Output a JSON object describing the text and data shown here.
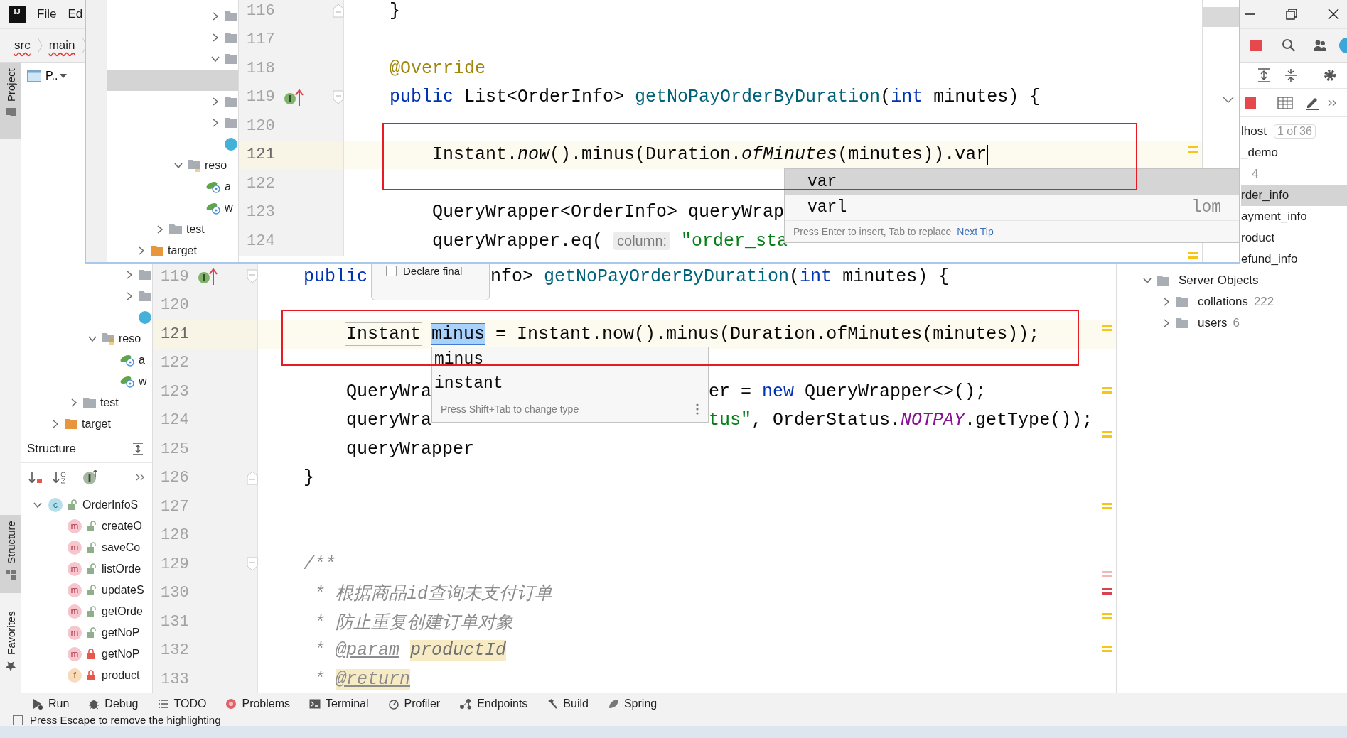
{
  "title_bar": {
    "logo": "IJ",
    "menu": [
      "File",
      "Ed"
    ]
  },
  "breadcrumbs": [
    "src",
    "main"
  ],
  "tool_stripes": [
    {
      "label": "Project",
      "selected": true
    },
    {
      "label": "Structure",
      "selected": true
    },
    {
      "label": "Favorites",
      "selected": false
    }
  ],
  "project_panel": {
    "title": "P..",
    "tree": [
      {
        "children": [
          {
            "children": [
              {
                "children": [
                  {
                    "children": [
                      {
                        "kind": "folder",
                        "expanded": false,
                        "selected": false
                      },
                      {
                        "kind": "folder",
                        "expanded": false,
                        "selected": false
                      },
                      {
                        "kind": "class",
                        "selected": false
                      }
                    ]
                  }
                ]
              },
              {
                "kind": "resources",
                "label": "reso",
                "expanded": true,
                "selected": false,
                "children": [
                  {
                    "kind": "config",
                    "label": "a",
                    "selected": false
                  },
                  {
                    "kind": "config",
                    "label": "w",
                    "selected": false
                  }
                ]
              }
            ]
          },
          {
            "kind": "folder",
            "label": "test",
            "expanded": false,
            "selected": false
          }
        ]
      },
      {
        "kind": "excluded",
        "label": "target",
        "expanded": false,
        "selected": false
      }
    ]
  },
  "structure_panel": {
    "title": "Structure",
    "tree": [
      {
        "label": "OrderInfoS",
        "kind": "class",
        "icon_text": "c",
        "locked": false,
        "expanded": true,
        "selected": false,
        "children": [
          {
            "label": "createO",
            "kind": "method",
            "icon_text": "m",
            "locked": false,
            "selected": false
          },
          {
            "label": "saveCo",
            "kind": "method",
            "icon_text": "m",
            "locked": false,
            "selected": false
          },
          {
            "label": "listOrde",
            "kind": "method",
            "icon_text": "m",
            "locked": false,
            "selected": false
          },
          {
            "label": "updateS",
            "kind": "method",
            "icon_text": "m",
            "locked": false,
            "selected": false
          },
          {
            "label": "getOrde",
            "kind": "method",
            "icon_text": "m",
            "locked": false,
            "selected": false
          },
          {
            "label": "getNoP",
            "kind": "method",
            "icon_text": "m",
            "locked": false,
            "selected": false
          },
          {
            "label": "getNoP",
            "kind": "method",
            "icon_text": "m",
            "locked": true,
            "selected": false
          },
          {
            "label": "product",
            "kind": "field",
            "icon_text": "f",
            "locked": true,
            "selected": false
          }
        ]
      }
    ]
  },
  "editor": {
    "lines": [
      {
        "n": "119",
        "current": false,
        "fold_start": true,
        "implements": true,
        "tokens": [
          {
            "kind": "kw",
            "t": "public"
          },
          {
            "kind": "gap_hint"
          },
          {
            "kind": "plain",
            "t": "nfo> "
          },
          {
            "kind": "fn",
            "t": "getNoPayOrderByDuration"
          },
          {
            "kind": "plain",
            "t": "("
          },
          {
            "kind": "kw",
            "t": "int"
          },
          {
            "kind": "plain",
            "t": " minutes) {"
          }
        ]
      },
      {
        "n": "120",
        "current": false
      },
      {
        "n": "121",
        "current": true,
        "indented": true,
        "tokens": [
          {
            "kind": "box",
            "t": "Instant"
          },
          {
            "kind": "sel",
            "t": "minus"
          },
          {
            "kind": "plain",
            "t": " = Instant.now().minus(Duration.ofMinutes(minutes));"
          }
        ]
      },
      {
        "n": "122",
        "current": false
      },
      {
        "n": "123",
        "current": false,
        "indented": true,
        "tokens": [
          {
            "kind": "plain",
            "t": "QueryWra"
          },
          {
            "kind": "gap_completion"
          },
          {
            "kind": "plain",
            "t": "er = "
          },
          {
            "kind": "kw",
            "t": "new"
          },
          {
            "kind": "plain",
            "t": " QueryWrapper<>();"
          }
        ]
      },
      {
        "n": "124",
        "current": false,
        "indented": true,
        "tokens": [
          {
            "kind": "plain",
            "t": "queryWra"
          },
          {
            "kind": "gap_completion"
          },
          {
            "kind": "str",
            "t": "tus\""
          },
          {
            "kind": "plain",
            "t": ", OrderStatus."
          },
          {
            "kind": "const",
            "t": "NOTPAY"
          },
          {
            "kind": "plain",
            "t": ".getType());"
          }
        ]
      },
      {
        "n": "125",
        "current": false,
        "indented": true,
        "tokens": [
          {
            "kind": "plain",
            "t": "queryWrapper"
          }
        ]
      },
      {
        "n": "126",
        "current": false,
        "fold_end": true,
        "tokens": [
          {
            "kind": "plain",
            "t": "}"
          }
        ]
      },
      {
        "n": "127",
        "current": false
      },
      {
        "n": "128",
        "current": false
      },
      {
        "n": "129",
        "current": false,
        "fold_start": true,
        "tokens": [
          {
            "kind": "comment",
            "t": "/**"
          }
        ]
      },
      {
        "n": "130",
        "current": false,
        "tokens": [
          {
            "kind": "comment",
            "t": " * 根据商品id查询未支付订单"
          }
        ]
      },
      {
        "n": "131",
        "current": false,
        "tokens": [
          {
            "kind": "comment",
            "t": " * 防止重复创建订单对象"
          }
        ]
      },
      {
        "n": "132",
        "current": false,
        "tokens": [
          {
            "kind": "comment",
            "t": " * "
          },
          {
            "kind": "doctag",
            "t": "@param"
          },
          {
            "kind": "docparam",
            "t": "productId"
          }
        ]
      },
      {
        "n": "133",
        "current": false,
        "tokens": [
          {
            "kind": "comment",
            "t": " * "
          },
          {
            "kind": "doctaghl",
            "t": "@return"
          }
        ]
      }
    ],
    "completion": {
      "items": [
        {
          "label": "minus",
          "selected": false
        },
        {
          "label": "instant",
          "selected": false
        }
      ],
      "hint": "Press Shift+Tab to change type"
    },
    "declare_final": {
      "label": "Declare final",
      "checked": false
    }
  },
  "database_panel": {
    "covered_rows": [
      {
        "label": "lhost",
        "badge": "1 of 36",
        "selected": false
      },
      {
        "label": "_demo",
        "selected": false
      },
      {
        "count": "4",
        "selected": false
      },
      {
        "label": "rder_info",
        "selected": true
      },
      {
        "label": "ayment_info",
        "selected": false
      },
      {
        "label": "roduct",
        "selected": false
      },
      {
        "label": "efund_info",
        "selected": false
      }
    ],
    "tree": [
      {
        "label": "Server Objects",
        "kind": "folder",
        "expanded": true,
        "selected": false,
        "children": [
          {
            "label": "collations",
            "count": "222",
            "kind": "folder",
            "expanded": false,
            "selected": false
          },
          {
            "label": "users",
            "count": "6",
            "kind": "folder",
            "expanded": false,
            "selected": false
          }
        ]
      }
    ]
  },
  "tool_window_bar": [
    {
      "label": "Run",
      "kind": "run"
    },
    {
      "label": "Debug",
      "kind": "debug"
    },
    {
      "label": "TODO",
      "kind": "todo"
    },
    {
      "label": "Problems",
      "kind": "problems"
    },
    {
      "label": "Terminal",
      "kind": "terminal"
    },
    {
      "label": "Profiler",
      "kind": "profiler"
    },
    {
      "label": "Endpoints",
      "kind": "endpoints"
    },
    {
      "label": "Build",
      "kind": "build"
    },
    {
      "label": "Spring",
      "kind": "spring"
    }
  ],
  "status_bar": {
    "message": "Press Escape to remove the highlighting"
  },
  "overlay": {
    "project_tree": [
      {
        "children": [
          {
            "children": [
              {
                "children": [
                  {
                    "children": [
                      {
                        "kind": "folder",
                        "expanded": false,
                        "selected": false
                      },
                      {
                        "kind": "folder",
                        "expanded": false,
                        "selected": false
                      },
                      {
                        "kind": "folder",
                        "expanded": true,
                        "selected": false,
                        "children": [
                          {
                            "selected": true
                          }
                        ]
                      },
                      {
                        "kind": "folder",
                        "expanded": false,
                        "selected": false
                      },
                      {
                        "kind": "folder",
                        "expanded": false,
                        "selected": false
                      },
                      {
                        "kind": "class",
                        "selected": false
                      }
                    ]
                  }
                ]
              },
              {
                "kind": "resources",
                "label": "reso",
                "expanded": true,
                "selected": false,
                "children": [
                  {
                    "kind": "config",
                    "label": "a",
                    "selected": false
                  },
                  {
                    "kind": "config",
                    "label": "w",
                    "selected": false
                  }
                ]
              }
            ]
          },
          {
            "kind": "folder",
            "label": "test",
            "expanded": false,
            "selected": false
          }
        ]
      },
      {
        "kind": "excluded",
        "label": "target",
        "expanded": false,
        "selected": false
      }
    ],
    "lines": [
      {
        "n": "116",
        "current": false,
        "fold_end": true,
        "tokens": [
          {
            "kind": "plain",
            "t": "}"
          }
        ]
      },
      {
        "n": "117",
        "current": false
      },
      {
        "n": "118",
        "current": false,
        "tokens": [
          {
            "kind": "ann",
            "t": "@Override"
          }
        ]
      },
      {
        "n": "119",
        "current": false,
        "fold_start": true,
        "implements": true,
        "tokens": [
          {
            "kind": "kw",
            "t": "public"
          },
          {
            "kind": "plain",
            "t": " List<OrderInfo> "
          },
          {
            "kind": "fn",
            "t": "getNoPayOrderByDuration"
          },
          {
            "kind": "plain",
            "t": "("
          },
          {
            "kind": "kw",
            "t": "int"
          },
          {
            "kind": "plain",
            "t": " minutes) {"
          }
        ]
      },
      {
        "n": "120",
        "current": false
      },
      {
        "n": "121",
        "current": true,
        "indented": true,
        "tokens": [
          {
            "kind": "plain",
            "t": "Instant."
          },
          {
            "kind": "ital",
            "t": "now"
          },
          {
            "kind": "plain",
            "t": "().minus(Duration."
          },
          {
            "kind": "ital",
            "t": "ofMinutes"
          },
          {
            "kind": "plain",
            "t": "(minutes)).var"
          },
          {
            "kind": "caret"
          }
        ]
      },
      {
        "n": "122",
        "current": false
      },
      {
        "n": "123",
        "current": false,
        "indented": true,
        "tokens": [
          {
            "kind": "plain",
            "t": "QueryWrapper<OrderInfo> queryWrap"
          }
        ]
      },
      {
        "n": "124",
        "current": false,
        "indented": true,
        "tokens": [
          {
            "kind": "plain",
            "t": "queryWrapper.eq( "
          },
          {
            "kind": "hint",
            "t": "column:"
          },
          {
            "kind": "str",
            "t": "\"order_sta"
          }
        ]
      }
    ],
    "completion": {
      "items": [
        {
          "label": "var",
          "selected": true
        },
        {
          "label": "varl",
          "source": "lom",
          "selected": false
        }
      ],
      "hint": "Press Enter to insert, Tab to replace",
      "link": "Next Tip"
    }
  }
}
